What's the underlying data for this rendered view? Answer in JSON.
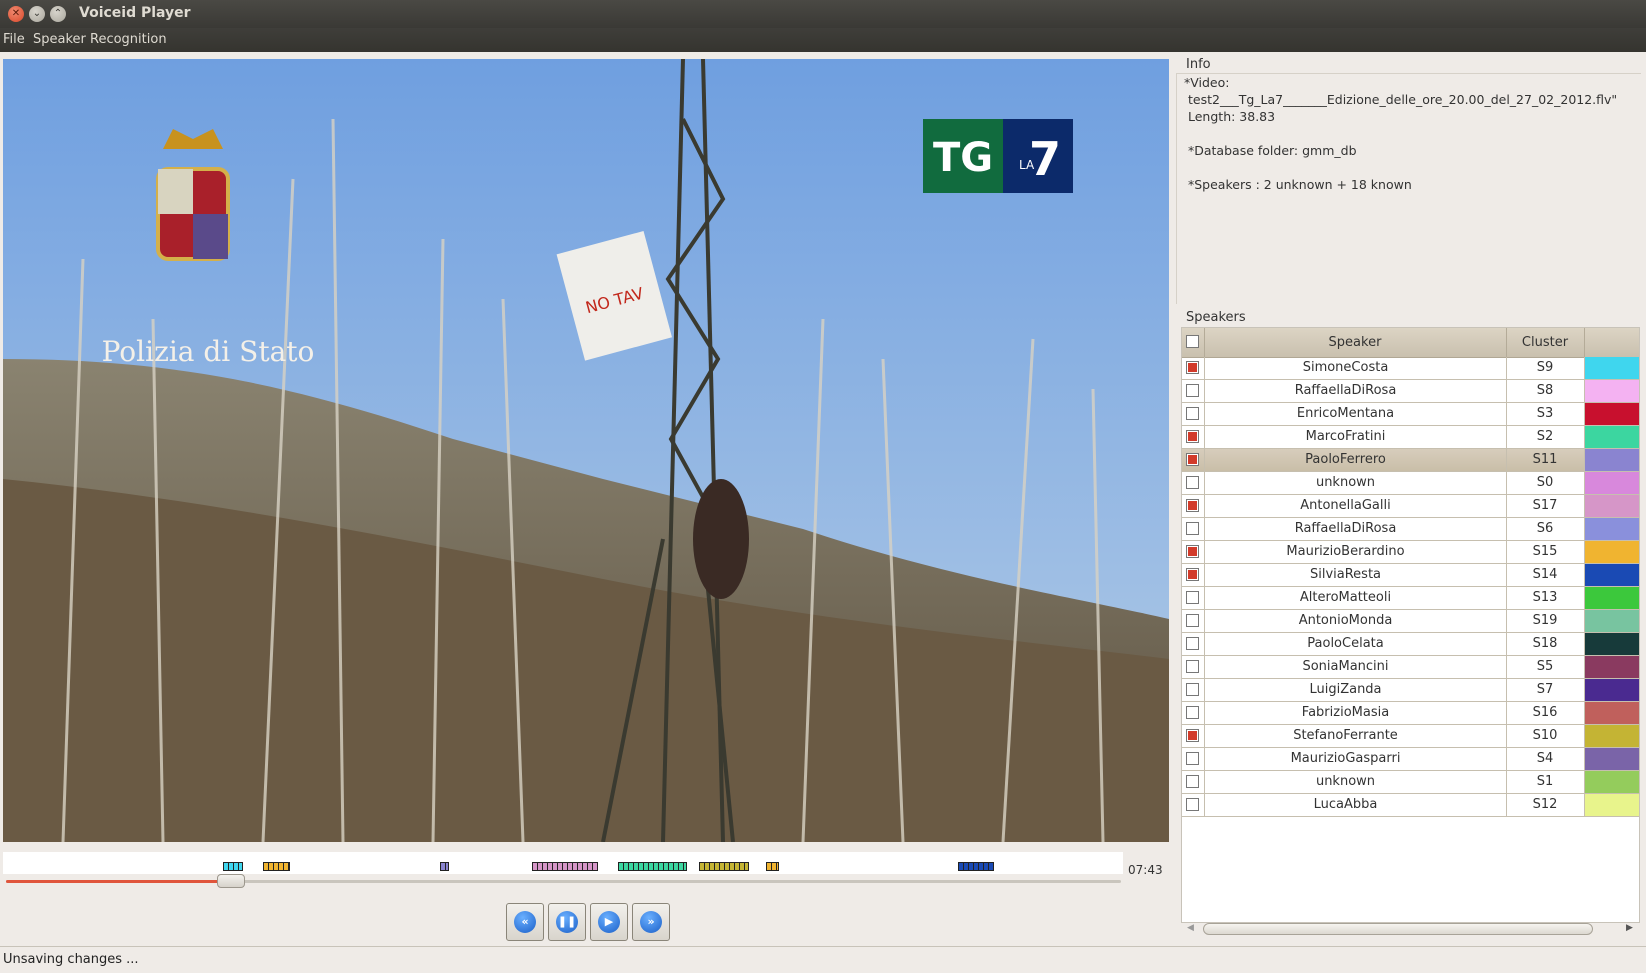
{
  "window": {
    "title": "Voiceid Player"
  },
  "menu": {
    "file": "File",
    "speaker_recognition": "Speaker Recognition"
  },
  "video": {
    "logo_text": "Polizia di Stato",
    "channel_logo_tg": "TG",
    "channel_logo_la": "LA",
    "channel_logo_7": "7",
    "banner_text": "NO TAV"
  },
  "player": {
    "time": "07:43",
    "progress_fraction": 0.2
  },
  "controls": {
    "rewind_icon": "fast-backward-icon",
    "pause_icon": "pause-icon",
    "play_icon": "play-icon",
    "forward_icon": "fast-forward-icon"
  },
  "status": {
    "text": "Unsaving changes ..."
  },
  "info": {
    "title": "Info",
    "video_label": "*Video:",
    "video_file": "test2___Tg_La7_______Edizione_delle_ore_20.00_del_27_02_2012.flv\"",
    "length": "Length: 38.83",
    "db_folder": "*Database folder: gmm_db",
    "speakers": "*Speakers : 2 unknown + 18 known"
  },
  "speakers_panel": {
    "title": "Speakers",
    "col_speaker": "Speaker",
    "col_cluster": "Cluster",
    "rows": [
      {
        "name": "SimoneCosta",
        "cluster": "S9",
        "color": "#3fd6ee",
        "checked": true
      },
      {
        "name": "RaffaellaDiRosa",
        "cluster": "S8",
        "color": "#f4b2f2",
        "checked": false
      },
      {
        "name": "EnricoMentana",
        "cluster": "S3",
        "color": "#c8102e",
        "checked": false
      },
      {
        "name": "MarcoFratini",
        "cluster": "S2",
        "color": "#3cd6a0",
        "checked": true
      },
      {
        "name": "PaoloFerrero",
        "cluster": "S11",
        "color": "#8a84d0",
        "checked": true,
        "selected": true
      },
      {
        "name": "unknown",
        "cluster": "S0",
        "color": "#d888dc",
        "checked": false
      },
      {
        "name": "AntonellaGalli",
        "cluster": "S17",
        "color": "#d696c8",
        "checked": true
      },
      {
        "name": "RaffaellaDiRosa",
        "cluster": "S6",
        "color": "#8a90dc",
        "checked": false
      },
      {
        "name": "MaurizioBerardino",
        "cluster": "S15",
        "color": "#f0b430",
        "checked": true
      },
      {
        "name": "SilviaResta",
        "cluster": "S14",
        "color": "#1a4ab4",
        "checked": true
      },
      {
        "name": "AlteroMatteoli",
        "cluster": "S13",
        "color": "#3cc83c",
        "checked": false
      },
      {
        "name": "AntonioMonda",
        "cluster": "S19",
        "color": "#78c4a0",
        "checked": false
      },
      {
        "name": "PaoloCelata",
        "cluster": "S18",
        "color": "#173a3a",
        "checked": false
      },
      {
        "name": "SoniaMancini",
        "cluster": "S5",
        "color": "#8a3a60",
        "checked": false
      },
      {
        "name": "LuigiZanda",
        "cluster": "S7",
        "color": "#4a2a90",
        "checked": false
      },
      {
        "name": "FabrizioMasia",
        "cluster": "S16",
        "color": "#c0605c",
        "checked": false
      },
      {
        "name": "StefanoFerrante",
        "cluster": "S10",
        "color": "#c4b434",
        "checked": true
      },
      {
        "name": "MaurizioGasparri",
        "cluster": "S4",
        "color": "#7a64a8",
        "checked": false
      },
      {
        "name": "unknown",
        "cluster": "S1",
        "color": "#94cc5c",
        "checked": false
      },
      {
        "name": "LucaAbba",
        "cluster": "S12",
        "color": "#e8f48c",
        "checked": false
      }
    ]
  },
  "timeline_segments": [
    {
      "from": 0.196,
      "to": 0.214,
      "color": "#3fd6ee"
    },
    {
      "from": 0.232,
      "to": 0.234,
      "color": "#3fd6ee"
    },
    {
      "from": 0.232,
      "to": 0.256,
      "color": "#f0b430"
    },
    {
      "from": 0.39,
      "to": 0.398,
      "color": "#8a84d0"
    },
    {
      "from": 0.472,
      "to": 0.531,
      "color": "#d696c8"
    },
    {
      "from": 0.549,
      "to": 0.611,
      "color": "#3cd6a0"
    },
    {
      "from": 0.621,
      "to": 0.666,
      "color": "#c4b434"
    },
    {
      "from": 0.681,
      "to": 0.693,
      "color": "#f0b430"
    },
    {
      "from": 0.853,
      "to": 0.885,
      "color": "#1a4ab4"
    }
  ]
}
